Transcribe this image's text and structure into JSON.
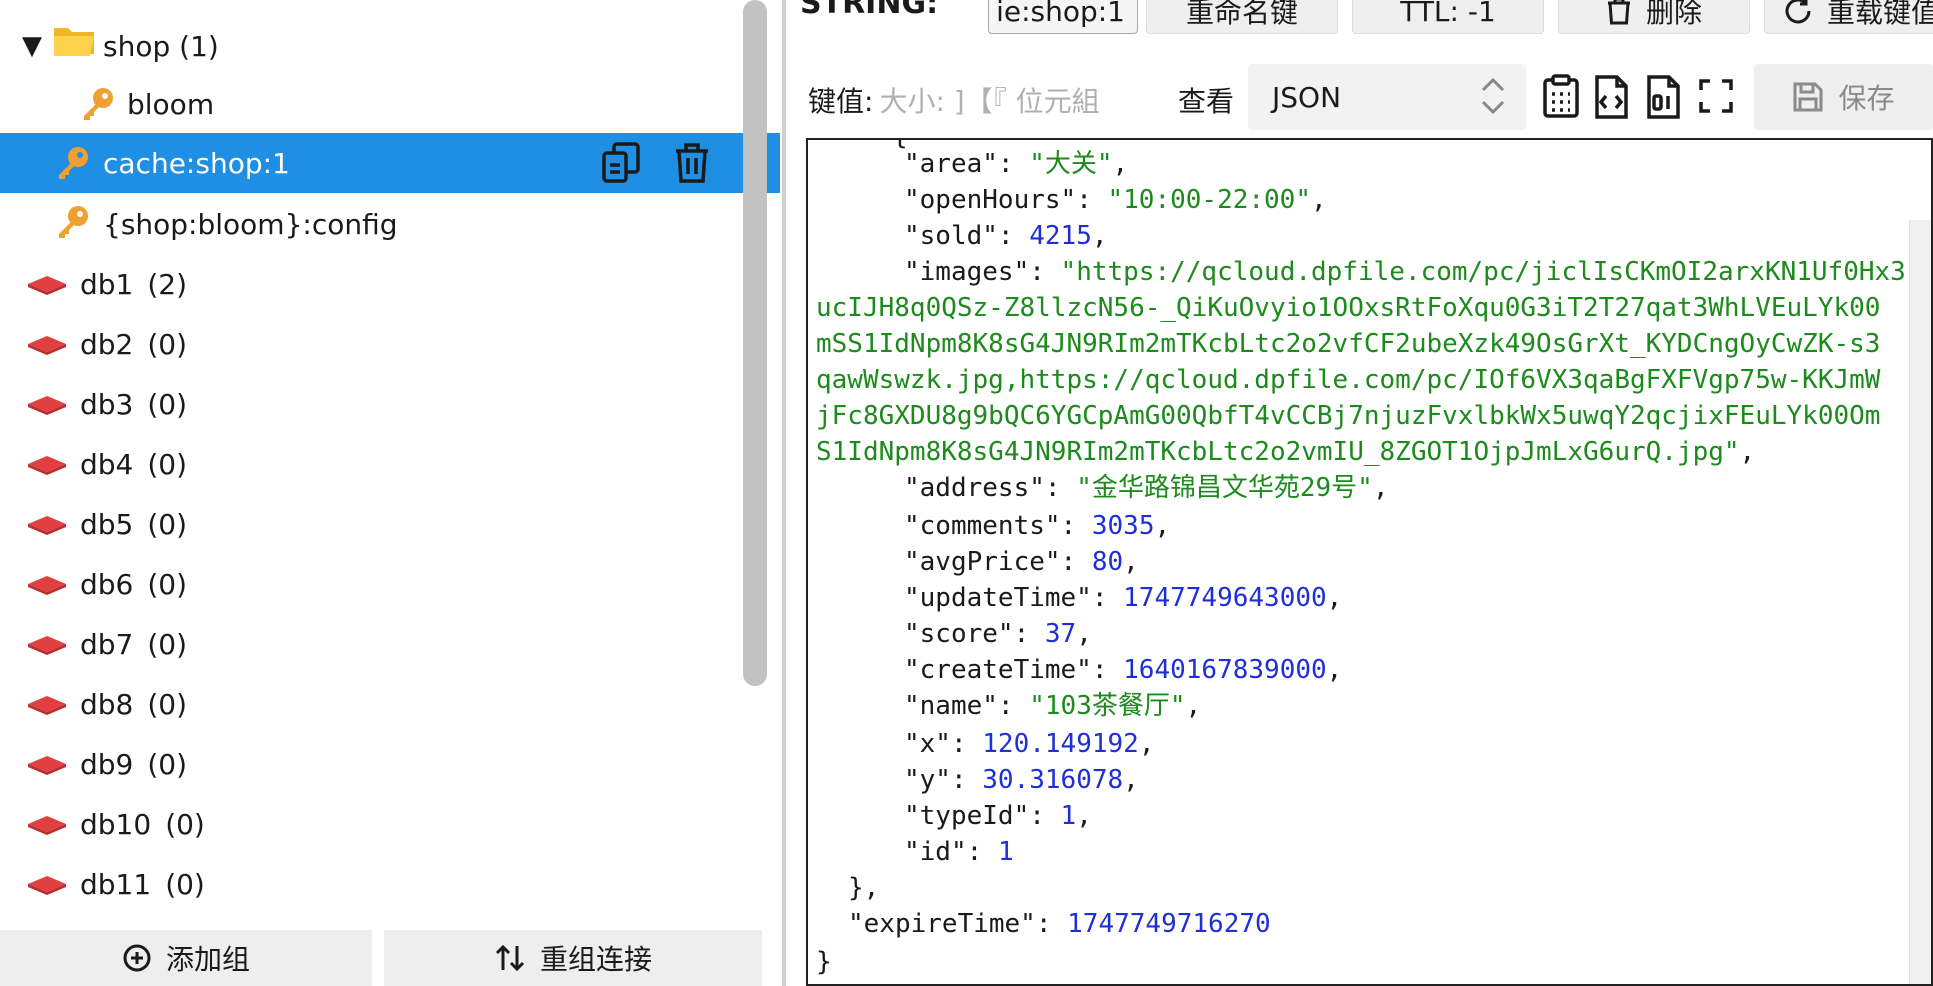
{
  "colors": {
    "selection": "#1f8fe3",
    "key_icon": "#f0a030",
    "db_icon": "#e04040",
    "json_string": "#1c8b1c",
    "json_number": "#1e2fd6"
  },
  "tree": {
    "folder": {
      "label": "shop",
      "count": "(1)"
    },
    "keys": [
      {
        "label": "bloom"
      },
      {
        "label": "cache:shop:1"
      },
      {
        "label": "{shop:bloom}:config"
      }
    ],
    "dbs": [
      {
        "label": "db1",
        "count": "(2)"
      },
      {
        "label": "db2",
        "count": "(0)"
      },
      {
        "label": "db3",
        "count": "(0)"
      },
      {
        "label": "db4",
        "count": "(0)"
      },
      {
        "label": "db5",
        "count": "(0)"
      },
      {
        "label": "db6",
        "count": "(0)"
      },
      {
        "label": "db7",
        "count": "(0)"
      },
      {
        "label": "db8",
        "count": "(0)"
      },
      {
        "label": "db9",
        "count": "(0)"
      },
      {
        "label": "db10",
        "count": "(0)"
      },
      {
        "label": "db11",
        "count": "(0)"
      }
    ]
  },
  "bottom": {
    "add_group": "添加组",
    "regroup": "重组连接"
  },
  "toolbar": {
    "type_label": "STRING:",
    "key_name": "ie:shop:1",
    "rename": "重命名键",
    "ttl": "TTL: -1",
    "delete": "删除",
    "reload": "重载键值"
  },
  "value_bar": {
    "value_label": "键值:",
    "size_meta": "大小: ]【『 位元組",
    "view_label": "查看",
    "format": "JSON",
    "save": "保存"
  },
  "json": {
    "area_key": "\"area\"",
    "area_val": "\"大关\"",
    "openHours_key": "\"openHours\"",
    "openHours_val": "\"10:00-22:00\"",
    "sold_key": "\"sold\"",
    "sold_val": "4215",
    "images_key": "\"images\"",
    "images_val_1": "\"https://qcloud.dpfile.com/pc/jiclIsCKmOI2arxKN1Uf0Hx3",
    "images_val_2": "ucIJH8q0QSz-Z8llzcN56-_QiKuOvyio1OOxsRtFoXqu0G3iT2T27qat3WhLVEuLYk00",
    "images_val_3": "mSS1IdNpm8K8sG4JN9RIm2mTKcbLtc2o2vfCF2ubeXzk49OsGrXt_KYDCngOyCwZK-s3",
    "images_val_4": "qawWswzk.jpg,https://qcloud.dpfile.com/pc/IOf6VX3qaBgFXFVgp75w-KKJmW",
    "images_val_5": "jFc8GXDU8g9bQC6YGCpAmG00QbfT4vCCBj7njuzFvxlbkWx5uwqY2qcjixFEuLYk00Om",
    "images_val_6": "S1IdNpm8K8sG4JN9RIm2mTKcbLtc2o2vmIU_8ZGOT1OjpJmLxG6urQ.jpg\"",
    "address_key": "\"address\"",
    "address_val": "\"金华路锦昌文华苑29号\"",
    "comments_key": "\"comments\"",
    "comments_val": "3035",
    "avgPrice_key": "\"avgPrice\"",
    "avgPrice_val": "80",
    "updateTime_key": "\"updateTime\"",
    "updateTime_val": "1747749643000",
    "score_key": "\"score\"",
    "score_val": "37",
    "createTime_key": "\"createTime\"",
    "createTime_val": "1640167839000",
    "name_key": "\"name\"",
    "name_val": "\"103茶餐厅\"",
    "x_key": "\"x\"",
    "x_val": "120.149192",
    "y_key": "\"y\"",
    "y_val": "30.316078",
    "typeId_key": "\"typeId\"",
    "typeId_val": "1",
    "id_key": "\"id\"",
    "id_val": "1",
    "expireTime_key": "\"expireTime\"",
    "expireTime_val": "1747749716270"
  }
}
